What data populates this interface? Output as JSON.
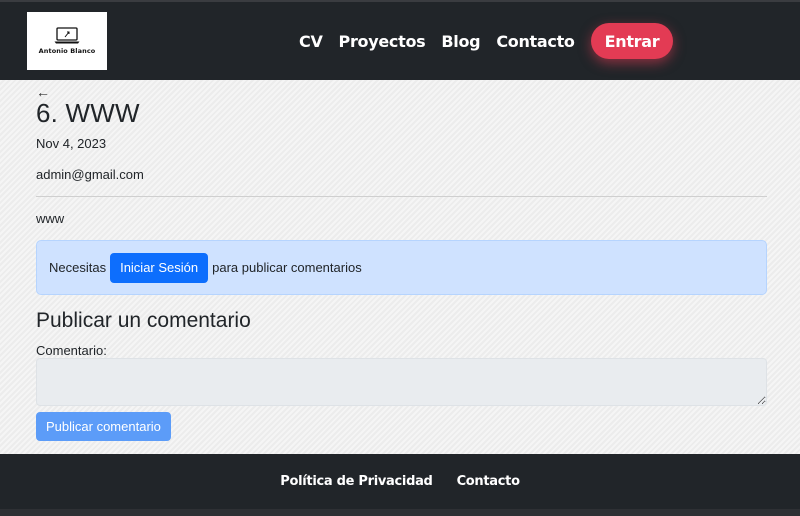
{
  "header": {
    "logo_text": "Antonio Blanco",
    "nav": [
      "CV",
      "Proyectos",
      "Blog",
      "Contacto"
    ],
    "login_button": "Entrar"
  },
  "post": {
    "back_arrow": "←",
    "title": "6. WWW",
    "date": "Nov 4, 2023",
    "author": "admin@gmail.com",
    "body": "www"
  },
  "alert": {
    "prefix": "Necesitas",
    "button": "Iniciar Sesión",
    "suffix": "para publicar comentarios"
  },
  "comment_form": {
    "heading": "Publicar un comentario",
    "label": "Comentario:",
    "value": "",
    "submit": "Publicar comentario"
  },
  "footer": {
    "links": [
      "Política de Privacidad",
      "Contacto"
    ]
  },
  "colors": {
    "nav_bg": "#212529",
    "accent": "#e33b54",
    "primary": "#0d6efd",
    "alert_bg": "#cfe2ff"
  }
}
